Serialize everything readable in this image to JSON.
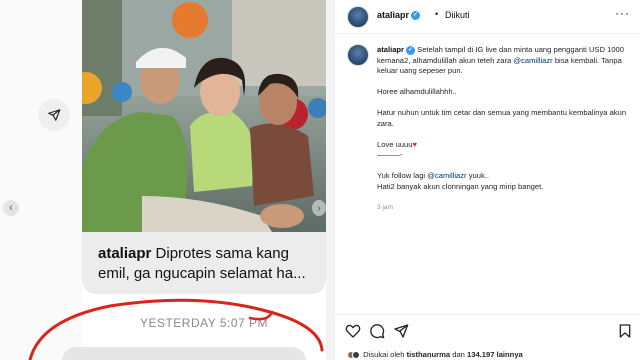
{
  "left": {
    "caption_user": "ataliapr",
    "caption_text": "Diprotes sama kang emil, ga ngucapin selamat ha...",
    "timestamp": "YESTERDAY 5:07 PM"
  },
  "header": {
    "username": "ataliapr",
    "separator": "•",
    "follow_status": "Diikuti",
    "more": "···"
  },
  "post": {
    "username": "ataliapr",
    "paragraph1_before": "Setelah tampil di IG live dan minta uang pengganti USD 1000 kemana2, alhamdulillah akun teteh zara ",
    "paragraph1_mention": "@camilliazr",
    "paragraph1_after": " bisa kembali. Tanpa keluar uang sepeser pun.",
    "paragraph2": "Horee alhamdulillahhh..",
    "paragraph3": "Hatur nuhun untuk tim cetar dan semua yang membantu kembalinya akun zara.",
    "paragraph4": "Love uuuu",
    "heart": "♥",
    "divider": "———-",
    "paragraph5_before": "Yuk follow lagi ",
    "paragraph5_mention": "@camilliazr",
    "paragraph5_after": " yuuk..",
    "paragraph6": "Hati2 banyak akun clonningan yang mirip banget.",
    "time": "3 jam"
  },
  "actions": {
    "liked_prefix": "Disukai oleh",
    "liked_user": "tisthanurma",
    "liked_mid": "dan",
    "liked_count": "134.197",
    "liked_suffix": "lainnya"
  },
  "colors": {
    "mention": "#00376b",
    "verified": "#3897f0",
    "annotation_red": "#d9251c"
  }
}
